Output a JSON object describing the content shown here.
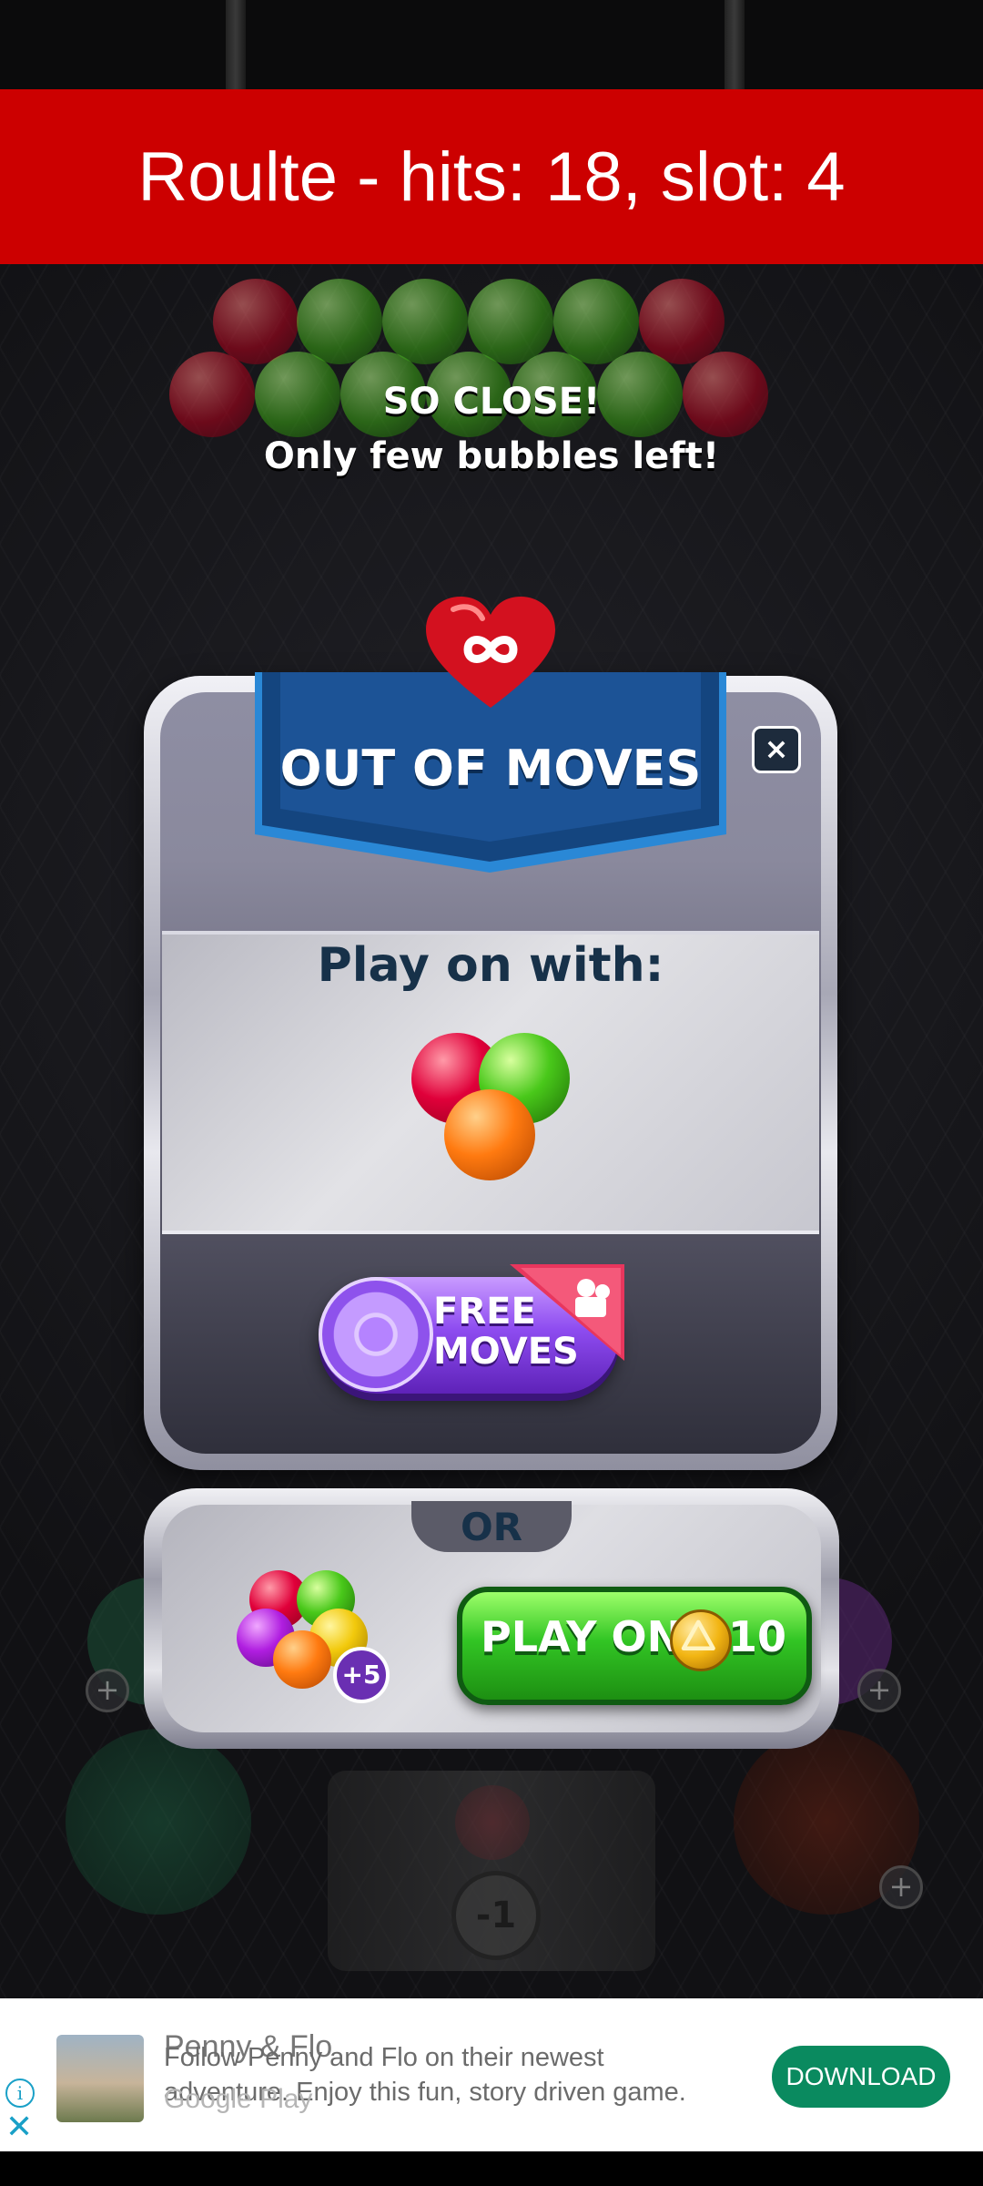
{
  "banner": {
    "text": "Roulte - hits: 18, slot: 4"
  },
  "messages": {
    "so_close": "SO CLOSE!",
    "few_left": "Only few bubbles left!"
  },
  "dialog": {
    "title": "OUT OF MOVES",
    "close_label": "×",
    "play_on_with": "Play on with:",
    "free_moves_line1": "FREE",
    "free_moves_line2": "MOVES",
    "or_label": "OR",
    "bonus_badge": "+5",
    "play_on_label": "PLAY ON",
    "play_on_cost": "10"
  },
  "game_bg": {
    "minus_one": "-1",
    "plus": "+"
  },
  "ad": {
    "title": "Penny & Flo",
    "description": "Follow Penny and Flo on their newest adventure. Enjoy this fun, story driven game.",
    "store": "Google Play",
    "download_label": "DOWNLOAD",
    "info_icon": "i",
    "close_icon": "✕"
  },
  "colors": {
    "banner": "#cc0000",
    "play_on_button": "#32c524",
    "free_moves_button": "#8e4cf0",
    "download_button": "#0a8a5f"
  }
}
